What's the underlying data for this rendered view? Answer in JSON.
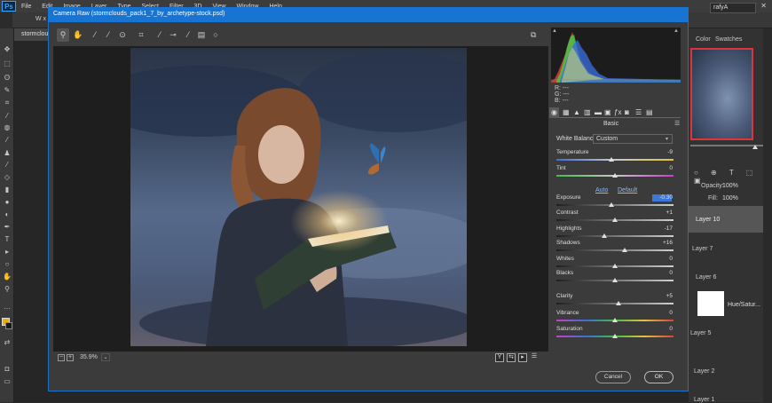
{
  "ps_menubar": {
    "logo": "Ps",
    "menus": [
      "File",
      "Edit",
      "Image",
      "Layer",
      "Type",
      "Select",
      "Filter",
      "3D",
      "View",
      "Window",
      "Help"
    ],
    "window_controls": [
      "—",
      "▢",
      "✕"
    ]
  },
  "ps_options": {
    "wx": "W x H",
    "right_field": "rafyA"
  },
  "doc_tab": {
    "label": "stormclou"
  },
  "right_panel": {
    "tab_color": "Color",
    "tab_swatches": "Swatches",
    "opacity_label": "Opacity:",
    "opacity_value": "100%",
    "fill_label": "Fill:",
    "fill_value": "100%",
    "layers": {
      "layer10": "Layer 10",
      "layer7": "Layer 7",
      "layer6": "Layer 6",
      "hue": "Hue/Satur...",
      "layer5": "Layer 5",
      "layer2": "Layer 2",
      "layer1": "Layer 1"
    }
  },
  "camera_raw": {
    "title": "Camera Raw (stormclouds_pack1_7_by_archetype-stock.psd)",
    "zoom_value": "35.9%",
    "zoom_minus": "−",
    "zoom_plus": "+",
    "rgb": {
      "r": "R:    ---",
      "g": "G:    ---",
      "b": "B:    ---"
    },
    "section_title": "Basic",
    "white_balance_label": "White Balance:",
    "white_balance_value": "Custom",
    "auto_label": "Auto",
    "default_label": "Default",
    "sliders": [
      {
        "label": "Temperature",
        "value": "-9",
        "pos": 0.47,
        "track": "temp"
      },
      {
        "label": "Tint",
        "value": "0",
        "pos": 0.5,
        "track": "tint"
      },
      {
        "label": "Exposure",
        "value": "-0.30",
        "pos": 0.47,
        "track": "gray"
      },
      {
        "label": "Contrast",
        "value": "+1",
        "pos": 0.5,
        "track": "gray"
      },
      {
        "label": "Highlights",
        "value": "-17",
        "pos": 0.41,
        "track": "gray"
      },
      {
        "label": "Shadows",
        "value": "+16",
        "pos": 0.58,
        "track": "gray"
      },
      {
        "label": "Whites",
        "value": "0",
        "pos": 0.5,
        "track": "gray"
      },
      {
        "label": "Blacks",
        "value": "0",
        "pos": 0.5,
        "track": "gray"
      },
      {
        "label": "Clarity",
        "value": "+5",
        "pos": 0.53,
        "track": "gray"
      },
      {
        "label": "Vibrance",
        "value": "0",
        "pos": 0.5,
        "track": "color"
      },
      {
        "label": "Saturation",
        "value": "0",
        "pos": 0.5,
        "track": "color"
      }
    ],
    "cancel_label": "Cancel",
    "ok_label": "OK"
  },
  "colors": {
    "titlebar": "#1874d3",
    "foreground": "#f0b000",
    "link": "#8fb8e8",
    "selection": "#3b78d8"
  }
}
